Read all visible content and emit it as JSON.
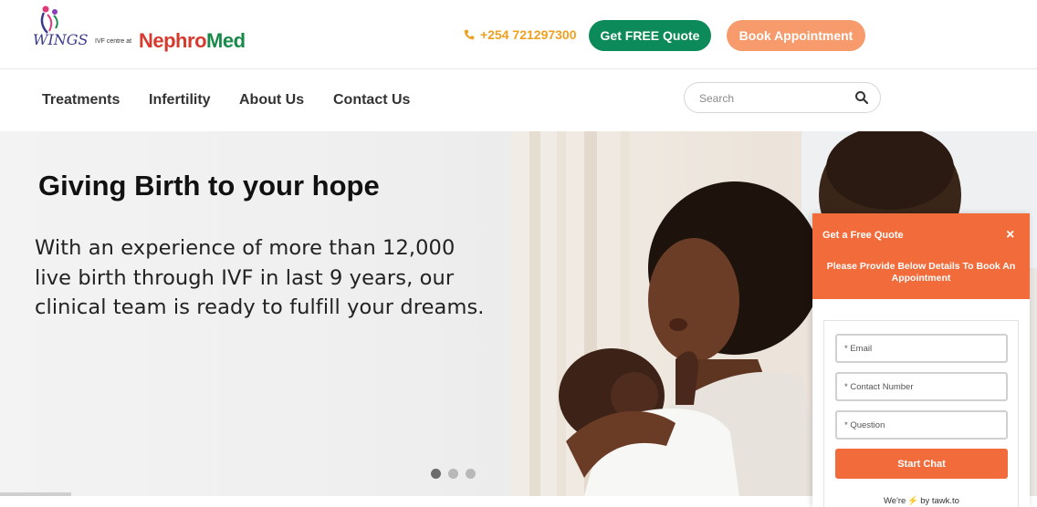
{
  "header": {
    "logo": {
      "wings_text": "WINGS",
      "ivf_text": "IVF centre at",
      "brand_part1": "Nephr",
      "brand_part2": "Med",
      "brand_o": "o"
    },
    "phone": "+254 721297300",
    "quote_button": "Get FREE Quote",
    "book_button": "Book Appointment"
  },
  "nav": {
    "items": [
      {
        "label": "Treatments"
      },
      {
        "label": "Infertility"
      },
      {
        "label": "About Us"
      },
      {
        "label": "Contact Us"
      }
    ],
    "search_placeholder": "Search"
  },
  "hero": {
    "title": "Giving Birth to your hope",
    "text_lines": [
      "With an experience of more than 12,000",
      "live birth through IVF in last 9 years, our",
      "clinical team is ready to fulfill your dreams."
    ],
    "slides": 3,
    "active_slide": 1
  },
  "chat": {
    "title": "Get a Free Quote",
    "close": "×",
    "subtitle": "Please Provide Below Details To Book An Appointment",
    "email_placeholder": "* Email",
    "contact_placeholder": "* Contact Number",
    "question_placeholder": "* Question",
    "submit": "Start Chat",
    "footer_prefix": "We're",
    "footer_suffix": "by tawk.to"
  },
  "colors": {
    "accent_green": "#0c8a5a",
    "accent_orange": "#f26b3a",
    "book_orange": "#f79a6c",
    "phone_gold": "#f0a020",
    "brand_red": "#d63a2f"
  }
}
